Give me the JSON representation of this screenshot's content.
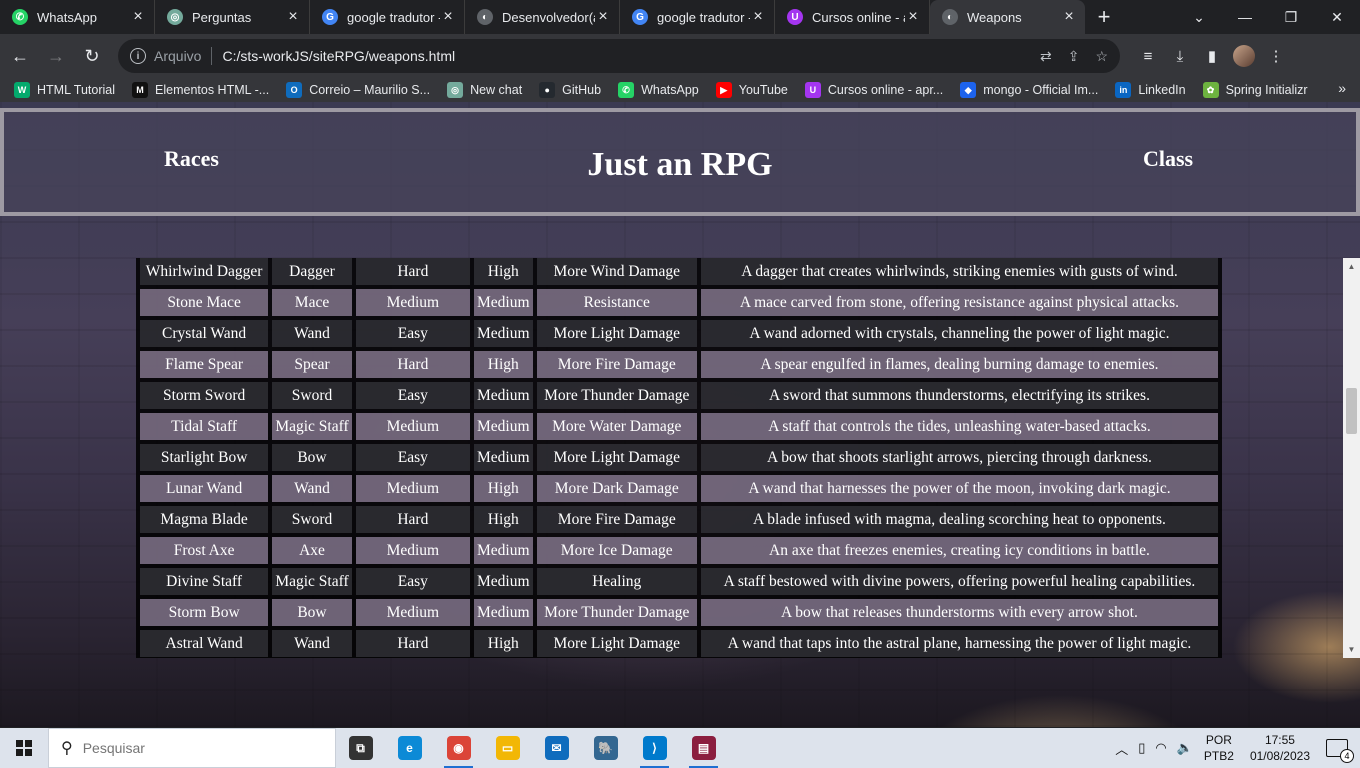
{
  "browser": {
    "tabs": [
      {
        "title": "WhatsApp",
        "icon": "whatsapp-icon",
        "color": "#25d366",
        "glyph": "✆"
      },
      {
        "title": "Perguntas",
        "icon": "chatgpt-icon",
        "color": "#74aa9c",
        "glyph": "◎"
      },
      {
        "title": "google tradutor -",
        "icon": "google-icon",
        "color": "#4285f4",
        "glyph": "G"
      },
      {
        "title": "Desenvolvedor(a)",
        "icon": "globe-icon",
        "color": "#5f6368",
        "glyph": "◐"
      },
      {
        "title": "google tradutor -",
        "icon": "google-icon",
        "color": "#4285f4",
        "glyph": "G"
      },
      {
        "title": "Cursos online - a",
        "icon": "udemy-icon",
        "color": "#a435f0",
        "glyph": "U"
      },
      {
        "title": "Weapons",
        "icon": "globe-icon",
        "color": "#5f6368",
        "glyph": "◐"
      }
    ],
    "active_tab": 6,
    "address": {
      "scheme": "Arquivo",
      "url": "C:/sts-workJS/siteRPG/weapons.html"
    },
    "bookmarks": [
      {
        "label": "HTML Tutorial",
        "icon": "w3schools-icon",
        "color": "#04aa6d",
        "glyph": "W"
      },
      {
        "label": "Elementos HTML -...",
        "icon": "mdn-icon",
        "color": "#111111",
        "glyph": "M"
      },
      {
        "label": "Correio – Maurilio S...",
        "icon": "outlook-icon",
        "color": "#0f6cbd",
        "glyph": "O"
      },
      {
        "label": "New chat",
        "icon": "chatgpt-icon",
        "color": "#74aa9c",
        "glyph": "◎"
      },
      {
        "label": "GitHub",
        "icon": "github-icon",
        "color": "#24292f",
        "glyph": "●"
      },
      {
        "label": "WhatsApp",
        "icon": "whatsapp-icon",
        "color": "#25d366",
        "glyph": "✆"
      },
      {
        "label": "YouTube",
        "icon": "youtube-icon",
        "color": "#ff0000",
        "glyph": "▶"
      },
      {
        "label": "Cursos online - apr...",
        "icon": "udemy-icon",
        "color": "#a435f0",
        "glyph": "U"
      },
      {
        "label": "mongo - Official Im...",
        "icon": "docker-icon",
        "color": "#1d63ed",
        "glyph": "◆"
      },
      {
        "label": "LinkedIn",
        "icon": "linkedin-icon",
        "color": "#0a66c2",
        "glyph": "in"
      },
      {
        "label": "Spring Initializr",
        "icon": "spring-icon",
        "color": "#6db33f",
        "glyph": "✿"
      }
    ]
  },
  "site": {
    "title": "Just an RPG",
    "nav_left": "Races",
    "nav_right": "Class"
  },
  "weapons": [
    {
      "name": "Whirlwind Dagger",
      "type": "Dagger",
      "difficulty": "Hard",
      "damage": "High",
      "effect": "More Wind Damage",
      "description": "A dagger that creates whirlwinds, striking enemies with gusts of wind."
    },
    {
      "name": "Stone Mace",
      "type": "Mace",
      "difficulty": "Medium",
      "damage": "Medium",
      "effect": "Resistance",
      "description": "A mace carved from stone, offering resistance against physical attacks."
    },
    {
      "name": "Crystal Wand",
      "type": "Wand",
      "difficulty": "Easy",
      "damage": "Medium",
      "effect": "More Light Damage",
      "description": "A wand adorned with crystals, channeling the power of light magic."
    },
    {
      "name": "Flame Spear",
      "type": "Spear",
      "difficulty": "Hard",
      "damage": "High",
      "effect": "More Fire Damage",
      "description": "A spear engulfed in flames, dealing burning damage to enemies."
    },
    {
      "name": "Storm Sword",
      "type": "Sword",
      "difficulty": "Easy",
      "damage": "Medium",
      "effect": "More Thunder Damage",
      "description": "A sword that summons thunderstorms, electrifying its strikes."
    },
    {
      "name": "Tidal Staff",
      "type": "Magic Staff",
      "difficulty": "Medium",
      "damage": "Medium",
      "effect": "More Water Damage",
      "description": "A staff that controls the tides, unleashing water-based attacks."
    },
    {
      "name": "Starlight Bow",
      "type": "Bow",
      "difficulty": "Easy",
      "damage": "Medium",
      "effect": "More Light Damage",
      "description": "A bow that shoots starlight arrows, piercing through darkness."
    },
    {
      "name": "Lunar Wand",
      "type": "Wand",
      "difficulty": "Medium",
      "damage": "High",
      "effect": "More Dark Damage",
      "description": "A wand that harnesses the power of the moon, invoking dark magic."
    },
    {
      "name": "Magma Blade",
      "type": "Sword",
      "difficulty": "Hard",
      "damage": "High",
      "effect": "More Fire Damage",
      "description": "A blade infused with magma, dealing scorching heat to opponents."
    },
    {
      "name": "Frost Axe",
      "type": "Axe",
      "difficulty": "Medium",
      "damage": "Medium",
      "effect": "More Ice Damage",
      "description": "An axe that freezes enemies, creating icy conditions in battle."
    },
    {
      "name": "Divine Staff",
      "type": "Magic Staff",
      "difficulty": "Easy",
      "damage": "Medium",
      "effect": "Healing",
      "description": "A staff bestowed with divine powers, offering powerful healing capabilities."
    },
    {
      "name": "Storm Bow",
      "type": "Bow",
      "difficulty": "Medium",
      "damage": "Medium",
      "effect": "More Thunder Damage",
      "description": "A bow that releases thunderstorms with every arrow shot."
    },
    {
      "name": "Astral Wand",
      "type": "Wand",
      "difficulty": "Hard",
      "damage": "High",
      "effect": "More Light Damage",
      "description": "A wand that taps into the astral plane, harnessing the power of light magic."
    }
  ],
  "taskbar": {
    "search_placeholder": "Pesquisar",
    "apps": [
      {
        "icon": "task-view-icon",
        "color": "#333333",
        "glyph": "⧉",
        "running": false
      },
      {
        "icon": "edge-icon",
        "color": "#0c8ad6",
        "glyph": "e",
        "running": false
      },
      {
        "icon": "chrome-icon",
        "color": "#db4437",
        "glyph": "◉",
        "running": true
      },
      {
        "icon": "file-explorer-icon",
        "color": "#f2b705",
        "glyph": "▭",
        "running": false
      },
      {
        "icon": "mail-icon",
        "color": "#0f6cbd",
        "glyph": "✉",
        "running": false
      },
      {
        "icon": "postgresql-icon",
        "color": "#336791",
        "glyph": "🐘",
        "running": false
      },
      {
        "icon": "vscode-icon",
        "color": "#007acc",
        "glyph": "⟩",
        "running": true
      },
      {
        "icon": "winrar-icon",
        "color": "#8b1e3f",
        "glyph": "▤",
        "running": true
      }
    ],
    "language": "POR",
    "keyboard": "PTB2",
    "time": "17:55",
    "date": "01/08/2023",
    "notifications": "4"
  }
}
